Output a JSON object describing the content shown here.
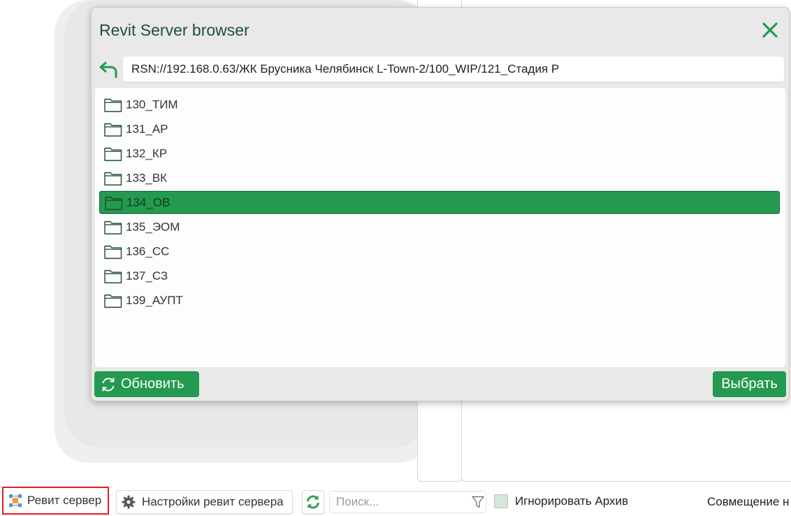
{
  "dialog": {
    "title": "Revit Server browser",
    "path_value": "RSN://192.168.0.63/ЖК Брусника Челябинск L-Town-2/100_WIP/121_Стадия Р",
    "folders": [
      {
        "name": "130_ТИМ",
        "selected": false
      },
      {
        "name": "131_АР",
        "selected": false
      },
      {
        "name": "132_КР",
        "selected": false
      },
      {
        "name": "133_ВК",
        "selected": false
      },
      {
        "name": "134_ОВ",
        "selected": true
      },
      {
        "name": "135_ЭОМ",
        "selected": false
      },
      {
        "name": "136_СС",
        "selected": false
      },
      {
        "name": "137_СЗ",
        "selected": false
      },
      {
        "name": "139_АУПТ",
        "selected": false
      }
    ],
    "refresh_label": "Обновить",
    "select_label": "Выбрать"
  },
  "toolbar": {
    "revit_server_label": "Ревит сервер",
    "settings_label": "Настройки ревит сервера",
    "search_placeholder": "Поиск...",
    "ignore_archive_label": "Игнорировать Архив",
    "ignore_archive_checked": false,
    "overlay_label": "Совмещение н"
  },
  "colors": {
    "accent_green": "#239a50",
    "title_green": "#1f5133",
    "highlight_red": "#e02020"
  }
}
